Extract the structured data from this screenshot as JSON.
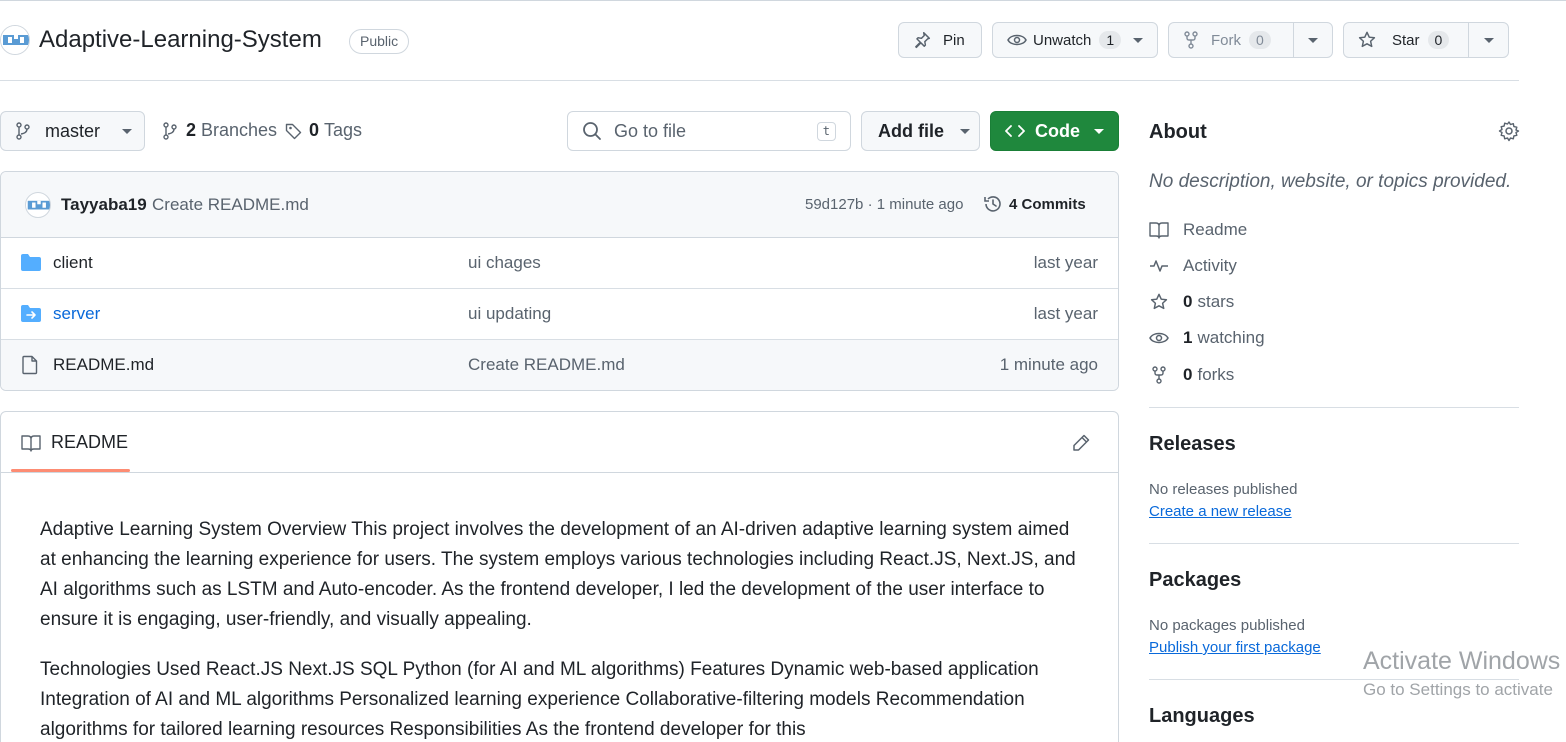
{
  "repo": {
    "name": "Adaptive-Learning-System",
    "visibility": "Public"
  },
  "header_actions": {
    "pin_label": "Pin",
    "unwatch_label": "Unwatch",
    "watch_count": "1",
    "fork_label": "Fork",
    "fork_count": "0",
    "star_label": "Star",
    "star_count": "0"
  },
  "toolbar": {
    "branch": "master",
    "branches_count": "2",
    "branches_label": "Branches",
    "tags_count": "0",
    "tags_label": "Tags",
    "search_placeholder": "Go to file",
    "search_shortcut": "t",
    "add_file_label": "Add file",
    "code_label": "Code"
  },
  "latest_commit": {
    "author": "Tayyaba19",
    "message": "Create README.md",
    "hash_time": "59d127b · 1 minute ago",
    "commits_label": "4 Commits"
  },
  "files": [
    {
      "name": "client",
      "message": "ui chages",
      "date": "last year",
      "type": "folder"
    },
    {
      "name": "server",
      "message": "ui updating",
      "date": "last year",
      "type": "submodule"
    },
    {
      "name": "README.md",
      "message": "Create README.md",
      "date": "1 minute ago",
      "type": "file"
    }
  ],
  "readme": {
    "tab_label": "README",
    "paragraph1": "Adaptive Learning System Overview This project involves the development of an AI-driven adaptive learning system aimed at enhancing the learning experience for users. The system employs various technologies including React.JS, Next.JS, and AI algorithms such as LSTM and Auto-encoder. As the frontend developer, I led the development of the user interface to ensure it is engaging, user-friendly, and visually appealing.",
    "paragraph2": "Technologies Used React.JS Next.JS SQL Python (for AI and ML algorithms) Features Dynamic web-based application Integration of AI and ML algorithms Personalized learning experience Collaborative-filtering models Recommendation algorithms for tailored learning resources Responsibilities As the frontend developer for this"
  },
  "about": {
    "title": "About",
    "description": "No description, website, or topics provided.",
    "readme": "Readme",
    "activity": "Activity",
    "stars_count": "0",
    "stars_label": "stars",
    "watching_count": "1",
    "watching_label": "watching",
    "forks_count": "0",
    "forks_label": "forks"
  },
  "releases": {
    "title": "Releases",
    "empty": "No releases published",
    "link": "Create a new release"
  },
  "packages": {
    "title": "Packages",
    "empty": "No packages published",
    "link": "Publish your first package"
  },
  "languages": {
    "title": "Languages"
  },
  "watermark": {
    "title": "Activate Windows",
    "subtitle": "Go to Settings to activate"
  },
  "colors": {
    "accent_green": "#1f883d",
    "link_blue": "#0969da",
    "folder_blue": "#54aeff",
    "tab_underline": "#fd8c73"
  }
}
